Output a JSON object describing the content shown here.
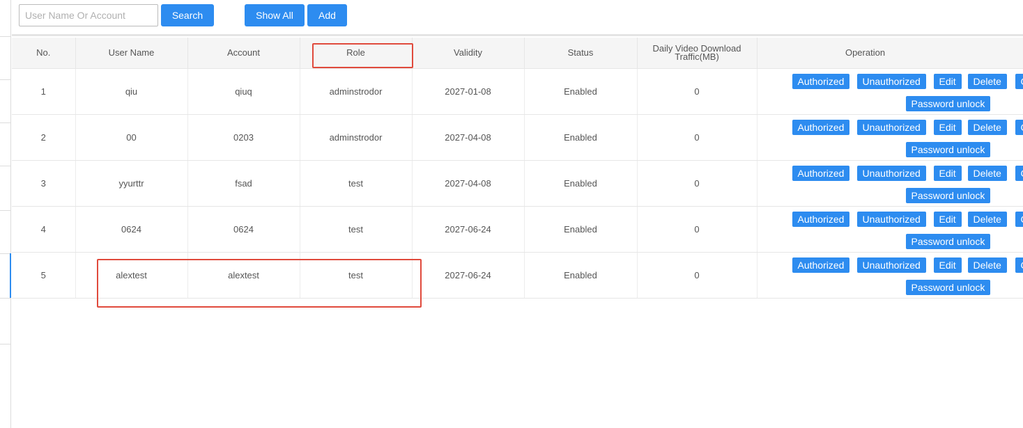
{
  "toolbar": {
    "search_placeholder": "User Name Or Account",
    "search_value": "",
    "search_label": "Search",
    "show_all_label": "Show All",
    "add_label": "Add"
  },
  "table": {
    "columns": [
      "No.",
      "User Name",
      "Account",
      "Role",
      "Validity",
      "Status",
      "Daily Video Download Traffic(MB)",
      "Operation"
    ],
    "rows": [
      {
        "no": "1",
        "user_name": "qiu",
        "account": "qiuq",
        "role": "adminstrodor",
        "validity": "2027-01-08",
        "status": "Enabled",
        "traffic": "0"
      },
      {
        "no": "2",
        "user_name": "00",
        "account": "0203",
        "role": "adminstrodor",
        "validity": "2027-04-08",
        "status": "Enabled",
        "traffic": "0"
      },
      {
        "no": "3",
        "user_name": "yyurttr",
        "account": "fsad",
        "role": "test",
        "validity": "2027-04-08",
        "status": "Enabled",
        "traffic": "0"
      },
      {
        "no": "4",
        "user_name": "0624",
        "account": "0624",
        "role": "test",
        "validity": "2027-06-24",
        "status": "Enabled",
        "traffic": "0"
      },
      {
        "no": "5",
        "user_name": "alextest",
        "account": "alextest",
        "role": "test",
        "validity": "2027-06-24",
        "status": "Enabled",
        "traffic": "0"
      }
    ],
    "actions": {
      "authorized": "Authorized",
      "unauthorized": "Unauthorized",
      "edit": "Edit",
      "delete": "Delete",
      "more": "C",
      "password_unlock": "Password unlock"
    }
  },
  "colors": {
    "primary": "#2d8cf0",
    "highlight": "#e04a3c",
    "header_bg": "#f5f5f5"
  }
}
